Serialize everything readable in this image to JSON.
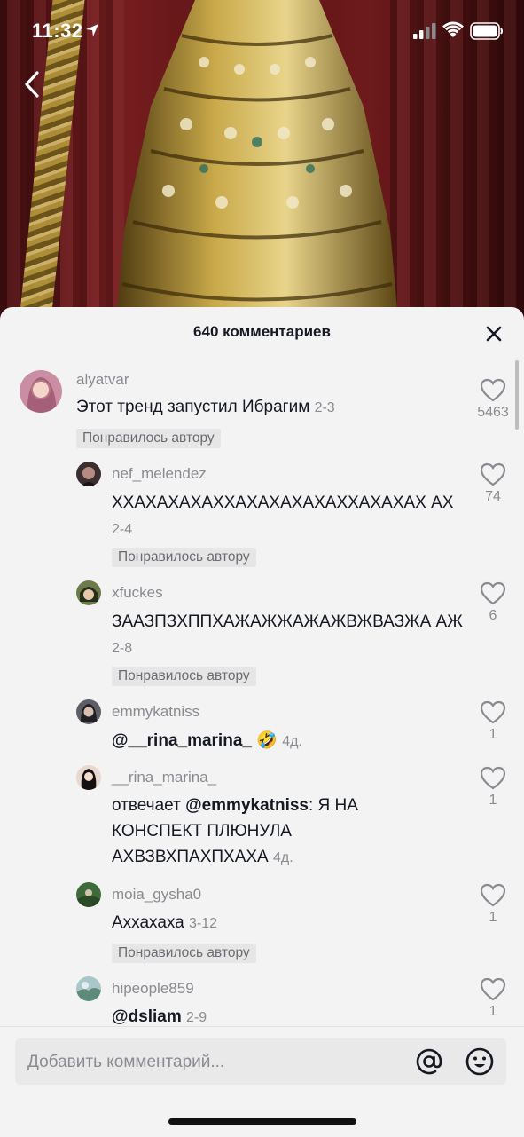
{
  "status_bar": {
    "time": "11:32"
  },
  "sheet": {
    "title": "640 комментариев",
    "input_placeholder": "Добавить комментарий..."
  },
  "badge_label": "Понравилось автору",
  "comments": [
    {
      "username": "alyatvar",
      "text": "Этот тренд запустил Ибрагим",
      "date": "2-3",
      "likes": "5463",
      "liked_by_author": true
    },
    {
      "username": "nef_melendez",
      "text": "ХХАХАХАХАХХАХАХАХАХАХХАХАХАХ АХ",
      "date": "2-4",
      "likes": "74",
      "liked_by_author": true
    },
    {
      "username": "xfuckes",
      "text": "ЗААЗПЗХППХАЖАЖЖАЖАЖВЖВАЗЖА АЖ",
      "date": "2-8",
      "likes": "6",
      "liked_by_author": true
    },
    {
      "username": "emmykatniss",
      "mention": "@__rina_marina_",
      "emoji": "🤣",
      "date": "4д.",
      "likes": "1",
      "liked_by_author": false
    },
    {
      "username": "__rina_marina_",
      "prefix": "отвечает",
      "mention": "@emmykatniss",
      "text": ": Я НА КОНСПЕКТ ПЛЮНУЛА АХВЗВХПАХПХАХА",
      "date": "4д.",
      "likes": "1",
      "liked_by_author": false
    },
    {
      "username": "moia_gysha0",
      "text": "Аххахаха",
      "date": "3-12",
      "likes": "1",
      "liked_by_author": true
    },
    {
      "username": "hipeople859",
      "mention": "@dsliam",
      "date": "2-9",
      "likes": "1",
      "liked_by_author": false
    }
  ],
  "colors": {
    "sheet_bg": "#f3f3f3",
    "text": "#161823",
    "muted": "#8a8b91",
    "badge_bg": "#e6e6e6"
  },
  "icons": [
    "back-icon",
    "location-arrow-icon",
    "signal-icon",
    "wifi-icon",
    "battery-icon",
    "close-icon",
    "heart-icon",
    "at-icon",
    "emoji-icon"
  ]
}
